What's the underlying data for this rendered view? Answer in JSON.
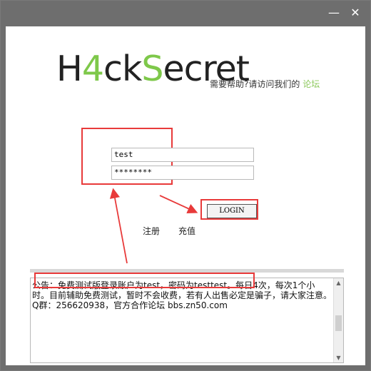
{
  "window": {
    "minimize_glyph": "—",
    "close_glyph": "✕"
  },
  "logo": {
    "part1": "H",
    "part2": "4",
    "part3": "ck",
    "part4": "S",
    "part5": "ecret"
  },
  "help": {
    "text": "需要帮助?请访问我们的",
    "link": "论坛"
  },
  "form": {
    "username_value": "test",
    "password_value": "********",
    "login_label": "LOGIN",
    "register_label": "注册",
    "recharge_label": "充值"
  },
  "notice": {
    "text": "公告：免费测试版登录账户为test，密码为testtest。每日4次，每次1个小时。目前辅助免费测试，暂时不会收费，若有人出售必定是骗子，请大家注意。Q群：256620938，官方合作论坛 bbs.zn50.com"
  },
  "annotation_color": "#e83a3a"
}
